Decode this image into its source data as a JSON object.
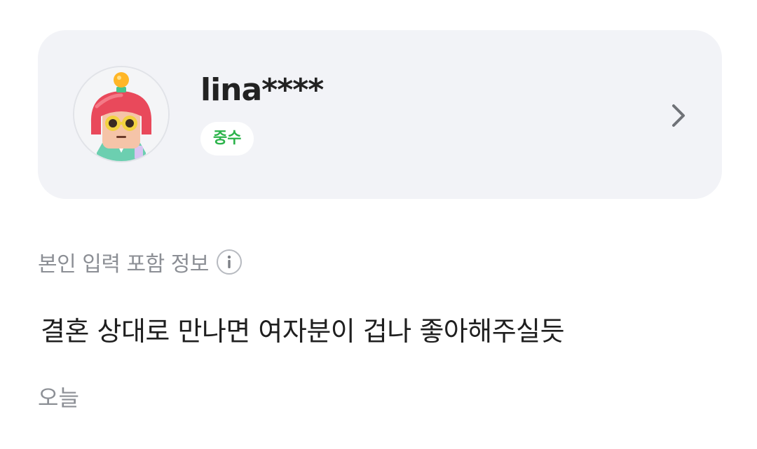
{
  "profile": {
    "username": "lina****",
    "grade": "중수",
    "avatar_icon": "lightbulb-helmet-character-avatar",
    "chevron_icon": "chevron-right-icon"
  },
  "info": {
    "label": "본인 입력 포함 정보",
    "icon": "info-icon"
  },
  "comment": {
    "text": "결혼 상대로 만나면 여자분이 겁나 좋아해주실듯",
    "date": "오늘"
  },
  "colors": {
    "card_background": "#f2f3f7",
    "grade_text": "#2bb34a",
    "secondary_text": "#8c8f95",
    "primary_text": "#1f1f1f"
  }
}
